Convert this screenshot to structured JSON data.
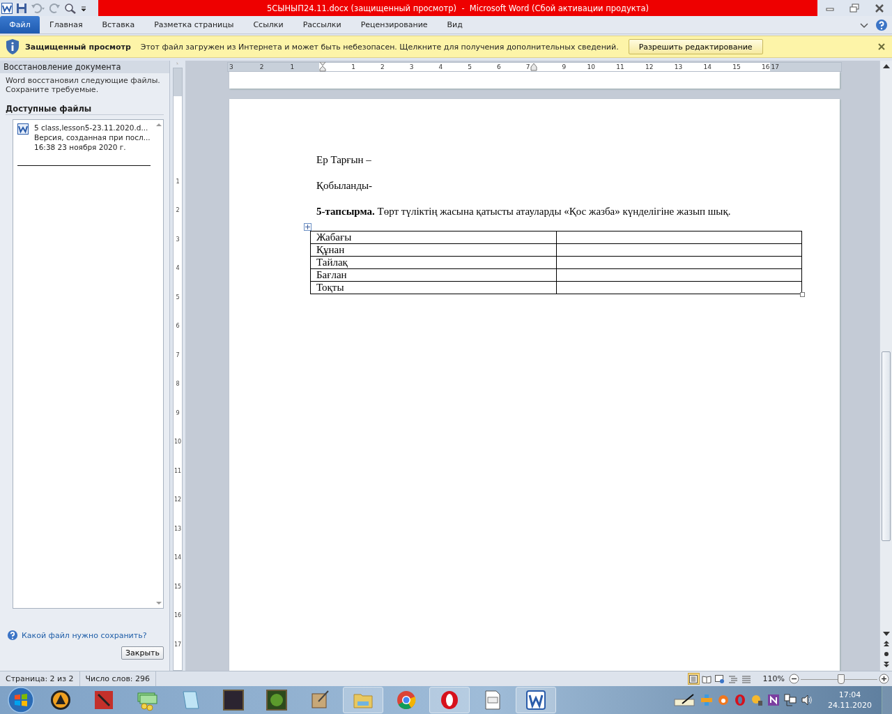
{
  "title_bar": {
    "title": "5СЫНЫП24.11.docx (защищенный просмотр)  -  Microsoft Word (Сбой активации продукта)"
  },
  "ribbon_tabs": [
    {
      "label": "Файл",
      "kind": "file"
    },
    {
      "label": "Главная",
      "kind": "tab"
    },
    {
      "label": "Вставка",
      "kind": "tab"
    },
    {
      "label": "Разметка страницы",
      "kind": "tab"
    },
    {
      "label": "Ссылки",
      "kind": "tab"
    },
    {
      "label": "Рассылки",
      "kind": "tab"
    },
    {
      "label": "Рецензирование",
      "kind": "tab"
    },
    {
      "label": "Вид",
      "kind": "tab"
    }
  ],
  "message_bar": {
    "title": "Защищенный просмотр",
    "text": "Этот файл загружен из Интернета и может быть небезопасен. Щелкните для получения дополнительных сведений.",
    "button": "Разрешить редактирование"
  },
  "recovery_pane": {
    "title": "Восстановление документа",
    "description": [
      "Word восстановил следующие файлы.",
      "Сохраните требуемые."
    ],
    "section_title": "Доступные файлы",
    "files": [
      {
        "name": "5 class,lesson5-23.11.2020.d...",
        "detail": "Версия, созданная при посл...",
        "time": "16:38 23 ноября 2020 г."
      }
    ],
    "help_link": "Какой файл нужно сохранить?",
    "close_button": "Закрыть"
  },
  "horizontal_ruler": {
    "left_labels": [
      "3",
      "2",
      "1"
    ],
    "text_labels": [
      "1",
      "2",
      "3",
      "4",
      "5",
      "6",
      "7"
    ],
    "right_labels": [
      "9",
      "10",
      "11",
      "12",
      "13",
      "14",
      "15",
      "16"
    ],
    "end_labels": [
      "17"
    ]
  },
  "vertical_ruler": {
    "labels": [
      "1",
      "2",
      "3",
      "4",
      "5",
      "6",
      "7",
      "8",
      "9",
      "10",
      "11",
      "12",
      "13",
      "14",
      "15",
      "16",
      "17"
    ]
  },
  "document": {
    "paragraphs": [
      "Ер Тарғын –",
      "Қобыланды-",
      "**5-тапсырма.** Төрт түліктің жасына қатысты атауларды «Қос жазба» күнделігіне жазып шық."
    ],
    "table": {
      "rows": [
        {
          "label": "Жабағы"
        },
        {
          "label": "Құнан"
        },
        {
          "label": "Тайлақ"
        },
        {
          "label": "Бағлан"
        },
        {
          "label": "Тоқты"
        }
      ]
    }
  },
  "status_bar": {
    "page": "Страница: 2 из 2",
    "words": "Число слов: 296",
    "views": [
      {
        "kind": "print",
        "selected": true
      },
      {
        "kind": "read",
        "selected": false
      },
      {
        "kind": "web",
        "selected": false
      },
      {
        "kind": "outline",
        "selected": false
      },
      {
        "kind": "draft",
        "selected": false
      }
    ],
    "zoom": "110%",
    "zoom_slider": {
      "level": 0.52
    }
  },
  "taskbar": {
    "apps": [
      {
        "kind": "triangle",
        "running": false
      },
      {
        "kind": "sword",
        "running": false
      },
      {
        "kind": "money",
        "running": false
      },
      {
        "kind": "notepad",
        "running": false
      },
      {
        "kind": "portrait",
        "running": false
      },
      {
        "kind": "creature",
        "running": false
      },
      {
        "kind": "scroll",
        "running": false
      },
      {
        "kind": "folder",
        "running": true
      },
      {
        "kind": "round-logo",
        "running": false
      },
      {
        "kind": "letter-o",
        "running": true
      },
      {
        "kind": "document",
        "running": false
      },
      {
        "kind": "letter-w",
        "running": true
      }
    ],
    "tray": [
      {
        "kind": "pen"
      },
      {
        "kind": "plus"
      },
      {
        "kind": "avast"
      },
      {
        "kind": "letter-o"
      },
      {
        "kind": "bulb"
      },
      {
        "kind": "letter-n"
      },
      {
        "kind": "network"
      },
      {
        "kind": "speaker"
      }
    ],
    "time": "17:04",
    "date": "24.11.2020"
  }
}
